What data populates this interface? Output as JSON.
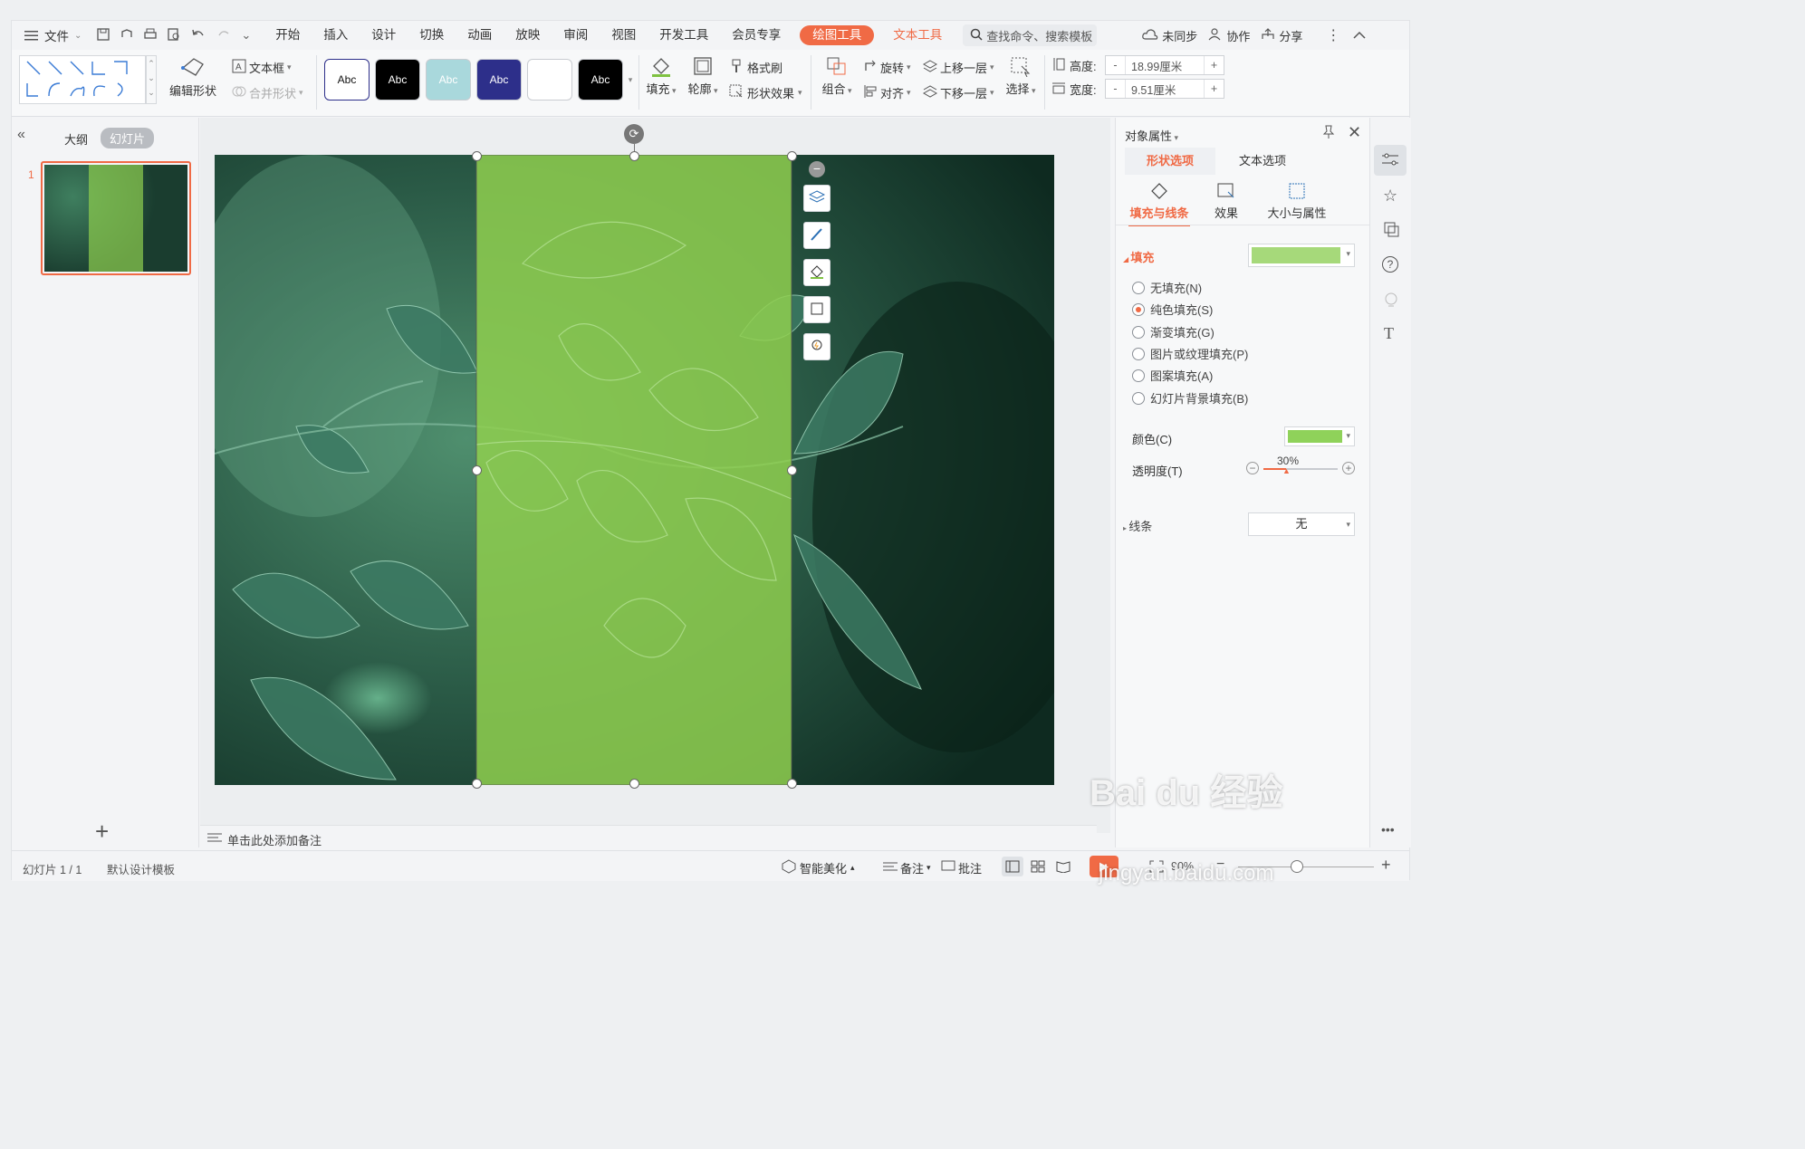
{
  "menu": {
    "file": "文件",
    "tabs": [
      "开始",
      "插入",
      "设计",
      "切换",
      "动画",
      "放映",
      "审阅",
      "视图",
      "开发工具",
      "会员专享"
    ],
    "draw_tools": "绘图工具",
    "text_tools": "文本工具",
    "search_placeholder": "查找命令、搜索模板",
    "sync": "未同步",
    "collab": "协作",
    "share": "分享"
  },
  "ribbon": {
    "edit_shape": "编辑形状",
    "text_box": "文本框",
    "merge_shape": "合并形状",
    "style_label": "Abc",
    "fill": "填充",
    "outline": "轮廓",
    "format_painter": "格式刷",
    "shape_effects": "形状效果",
    "group": "组合",
    "rotate": "旋转",
    "align": "对齐",
    "bring_forward": "上移一层",
    "send_backward": "下移一层",
    "select": "选择",
    "height_label": "高度:",
    "height_value": "18.99厘米",
    "width_label": "宽度:",
    "width_value": "9.51厘米",
    "minus": "-",
    "plus": "+"
  },
  "left_panel": {
    "outline_tab": "大纲",
    "slides_tab": "幻灯片",
    "slide_number": "1",
    "add": "+"
  },
  "notes": {
    "placeholder": "单击此处添加备注"
  },
  "right_panel": {
    "title": "对象属性",
    "tab_shape": "形状选项",
    "tab_text": "文本选项",
    "sub_fill_line": "填充与线条",
    "sub_effects": "效果",
    "sub_size": "大小与属性",
    "fill_section": "填充",
    "fill_options": [
      "无填充(N)",
      "纯色填充(S)",
      "渐变填充(G)",
      "图片或纹理填充(P)",
      "图案填充(A)",
      "幻灯片背景填充(B)"
    ],
    "selected_fill_index": 1,
    "color_label": "颜色(C)",
    "transparency_label": "透明度(T)",
    "transparency_value": "30%",
    "transparency_fraction": 0.3,
    "line_section": "线条",
    "line_value": "无",
    "fill_color": "#a6d97a",
    "color_swatch": "#8fd25a"
  },
  "status": {
    "slide_info": "幻灯片 1 / 1",
    "template": "默认设计模板",
    "smart_beautify": "智能美化",
    "notes": "备注",
    "comments": "批注",
    "zoom": "90%"
  },
  "watermark": {
    "main": "Bai du 经验",
    "url": "jingyan.baidu.com"
  },
  "colors": {
    "accent": "#f06a45",
    "overlay_green": "#8fcf4f"
  }
}
